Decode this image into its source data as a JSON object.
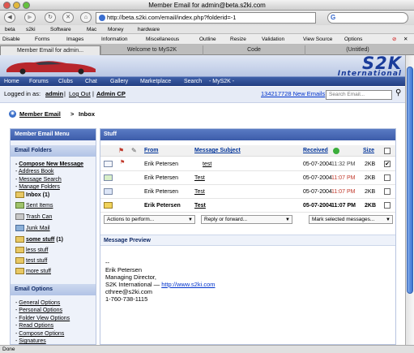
{
  "window": {
    "title": "Member Email for admin@beta.s2ki.com"
  },
  "browser": {
    "url": "http://beta.s2ki.com/email/index.php?folderid=-1",
    "search_icon_letter": "G",
    "bookmarks": [
      "beta",
      "s2ki",
      "Software",
      "Mac",
      "Money",
      "hardware"
    ],
    "dev_toolbar": [
      "Disable",
      "Forms",
      "Images",
      "Information",
      "Miscellaneous",
      "Outline",
      "Resize",
      "Validation",
      "View Source",
      "Options"
    ],
    "tabs": [
      "Member Email for admin...",
      "Welcome to MyS2K",
      "Code",
      "(Untitled)"
    ],
    "status": "Done"
  },
  "site": {
    "logo_top": "S2K",
    "logo_bottom": "International",
    "nav": [
      "Home",
      "Forums",
      "Clubs",
      "Chat",
      "Gallery",
      "Marketplace",
      "Search",
      "- MyS2K -"
    ],
    "login_prefix": "Logged in as:",
    "user": "admin",
    "logout": "Log Out",
    "admin_cp": "Admin CP",
    "separator": "|",
    "new_emails": "134217728 New Emails",
    "search_placeholder": "Search Email..."
  },
  "breadcrumb": {
    "root": "Member Email",
    "sep": ">",
    "current": "Inbox"
  },
  "sidebar": {
    "title": "Member Email Menu",
    "folders_title": "Email Folders",
    "actions": [
      "Compose New Message",
      "Address Book",
      "Message Search",
      "Manage Folders"
    ],
    "folders": [
      {
        "name": "Inbox",
        "count": "(1)"
      },
      {
        "name": "Sent Items",
        "count": ""
      },
      {
        "name": "Trash Can",
        "count": ""
      },
      {
        "name": "Junk Mail",
        "count": ""
      },
      {
        "name": "some stuff",
        "count": "(1)"
      },
      {
        "name": "less stuff",
        "count": ""
      },
      {
        "name": "test stuff",
        "count": ""
      },
      {
        "name": "more stuff",
        "count": ""
      }
    ],
    "options_title": "Email Options",
    "options": [
      "General Options",
      "Personal Options",
      "Folder View Options",
      "Read Options",
      "Compose Options",
      "Signatures"
    ]
  },
  "main": {
    "title": "Stuff",
    "columns": {
      "from": "From",
      "subject": "Message Subject",
      "received": "Received",
      "size": "Size"
    },
    "rows": [
      {
        "from": "Erik Petersen",
        "subject": "test",
        "date": "05-07-2004",
        "time": "11:32 PM",
        "size": "2KB",
        "checked": "✔",
        "flag": true,
        "unread": false
      },
      {
        "from": "Erik Petersen",
        "subject": "Test",
        "date": "05-07-2004",
        "time": "11:07 PM",
        "size": "2KB",
        "checked": "",
        "flag": false,
        "unread": false
      },
      {
        "from": "Erik Petersen",
        "subject": "Test",
        "date": "05-07-2004",
        "time": "11:07 PM",
        "size": "2KB",
        "checked": "",
        "flag": false,
        "unread": false
      },
      {
        "from": "Erik Petersen",
        "subject": "Test",
        "date": "05-07-2004",
        "time": "11:07 PM",
        "size": "2KB",
        "checked": "",
        "flag": false,
        "unread": true
      }
    ],
    "actions_select": "Actions to perform...",
    "reply_select": "Reply or forward...",
    "mark_select": "Mark selected messages...",
    "preview_title": "Message Preview",
    "preview_lines": [
      "--",
      "Erik Petersen",
      "Managing Director,",
      "S2K International —",
      "cthree@s2ki.com",
      "1-760-738-1115"
    ],
    "preview_link": "http://www.s2ki.com"
  },
  "colors": {
    "accent": "#3c5ca9",
    "link": "#0033cc",
    "flag": "#c0392b"
  }
}
